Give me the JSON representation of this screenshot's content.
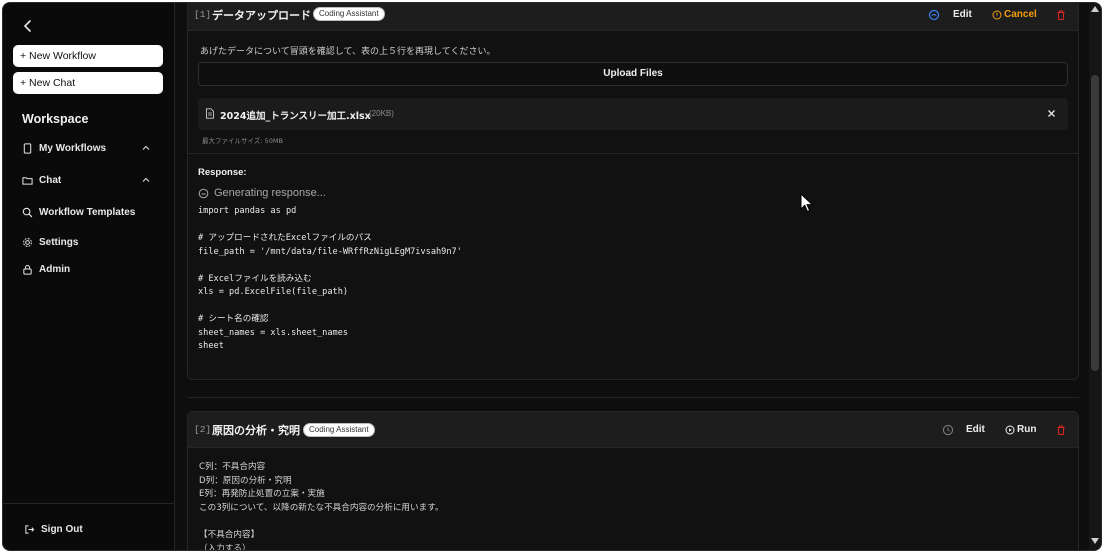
{
  "sidebar": {
    "new_workflow": "+ New Workflow",
    "new_chat": "+ New Chat",
    "workspace_title": "Workspace",
    "items": [
      {
        "label": "My Workflows",
        "icon": "tablet-icon"
      },
      {
        "label": "Chat",
        "icon": "folder-icon"
      },
      {
        "label": "Workflow Templates",
        "icon": "search-icon"
      },
      {
        "label": "Settings",
        "icon": "gear-icon"
      },
      {
        "label": "Admin",
        "icon": "lock-icon"
      }
    ],
    "sign_out": "Sign Out"
  },
  "steps": [
    {
      "number": "[1]",
      "title": "データアップロード",
      "badge": "Coding Assistant",
      "edit_label": "Edit",
      "action_label": "Cancel",
      "description": "あげたデータについて冒頭を確認して、表の上５行を再現してください。",
      "upload_label": "Upload Files",
      "file": {
        "name": "2024追加_トランスリー加工.xlsx",
        "size": "(20KB)"
      },
      "max_size": "最大ファイルサイズ: 50MB",
      "response_label": "Response:",
      "generating": "Generating response...",
      "code_lines": [
        "import pandas as pd",
        "",
        "# アップロードされたExcelファイルのパス",
        "file_path = '/mnt/data/file-WRffRzNigLEgM7ivsah9n7'",
        "",
        "# Excelファイルを読み込む",
        "xls = pd.ExcelFile(file_path)",
        "",
        "# シート名の確認",
        "sheet_names = xls.sheet_names",
        "sheet"
      ]
    },
    {
      "number": "[2]",
      "title": "原因の分析・究明",
      "badge": "Coding Assistant",
      "edit_label": "Edit",
      "action_label": "Run",
      "description_lines": [
        "C列：不具合内容",
        "D列：原因の分析・究明",
        "E列：再発防止処置の立案・実施",
        "この3列について、以降の新たな不具合内容の分析に用います。",
        "",
        "【不具合内容】",
        "（入力する）"
      ]
    }
  ],
  "colors": {
    "accent_blue": "#3b82f6",
    "accent_orange": "#f59e0b",
    "danger_red": "#dc2626"
  }
}
